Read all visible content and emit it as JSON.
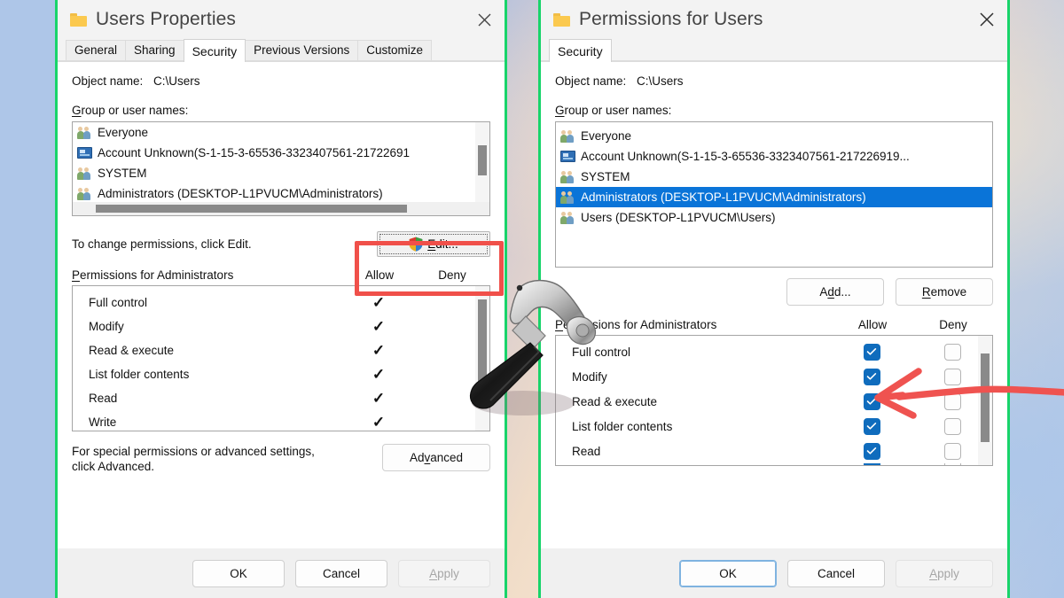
{
  "desktop": {
    "background_colors": [
      "#aec6e8",
      "#f6e3cd",
      "#d8cdd0"
    ],
    "border_color": "#18d46a"
  },
  "annotations": {
    "edit_highlight_color": "#f0504a",
    "arrow_color": "#ef5350",
    "hammer_icon": "hammer-icon",
    "arrow_icon": "red-arrow-icon",
    "edit_box_icon": "red-rectangle-highlight"
  },
  "left_dialog": {
    "title": "Users Properties",
    "folder_icon": "folder-icon",
    "close_icon": "close-icon",
    "tabs": [
      {
        "label": "General",
        "active": false
      },
      {
        "label": "Sharing",
        "active": false
      },
      {
        "label": "Security",
        "active": true
      },
      {
        "label": "Previous Versions",
        "active": false
      },
      {
        "label": "Customize",
        "active": false
      }
    ],
    "object_name_label": "Object name:",
    "object_name_value": "C:\\Users",
    "group_label": "Group or user names:",
    "group_items": [
      {
        "name": "Everyone",
        "icon": "users-group-icon",
        "selected": false
      },
      {
        "name": "Account Unknown(S-1-15-3-65536-3323407561-21722691",
        "icon": "unknown-account-icon",
        "selected": false
      },
      {
        "name": "SYSTEM",
        "icon": "users-group-icon",
        "selected": false
      },
      {
        "name": "Administrators (DESKTOP-L1PVUCM\\Administrators)",
        "icon": "users-group-icon",
        "selected": false
      }
    ],
    "change_hint": "To change permissions, click Edit.",
    "edit_button": "Edit...",
    "edit_button_icon": "uac-shield-icon",
    "permissions_label": "Permissions for Administrators",
    "allow_header": "Allow",
    "deny_header": "Deny",
    "permissions": [
      {
        "name": "Full control",
        "allow": "check",
        "deny": ""
      },
      {
        "name": "Modify",
        "allow": "check",
        "deny": ""
      },
      {
        "name": "Read & execute",
        "allow": "check",
        "deny": ""
      },
      {
        "name": "List folder contents",
        "allow": "check",
        "deny": ""
      },
      {
        "name": "Read",
        "allow": "check",
        "deny": ""
      },
      {
        "name": "Write",
        "allow": "check",
        "deny": ""
      }
    ],
    "advanced_note_line1": "For special permissions or advanced settings,",
    "advanced_note_line2": "click Advanced.",
    "advanced_button": "Advanced",
    "ok_button": "OK",
    "cancel_button": "Cancel",
    "apply_button": "Apply",
    "apply_disabled": true
  },
  "right_dialog": {
    "title": "Permissions for Users",
    "folder_icon": "folder-icon",
    "close_icon": "close-icon",
    "tabs": [
      {
        "label": "Security",
        "active": true
      }
    ],
    "object_name_label": "Object name:",
    "object_name_value": "C:\\Users",
    "group_label": "Group or user names:",
    "group_items": [
      {
        "name": "Everyone",
        "icon": "users-group-icon",
        "selected": false
      },
      {
        "name": "Account Unknown(S-1-15-3-65536-3323407561-217226919...",
        "icon": "unknown-account-icon",
        "selected": false
      },
      {
        "name": "SYSTEM",
        "icon": "users-group-icon",
        "selected": false
      },
      {
        "name": "Administrators (DESKTOP-L1PVUCM\\Administrators)",
        "icon": "users-group-icon",
        "selected": true
      },
      {
        "name": "Users (DESKTOP-L1PVUCM\\Users)",
        "icon": "users-group-icon",
        "selected": false
      }
    ],
    "add_button": "Add...",
    "remove_button": "Remove",
    "permissions_label": "Permissions for Administrators",
    "allow_header": "Allow",
    "deny_header": "Deny",
    "permissions": [
      {
        "name": "Full control",
        "allow": true,
        "deny": false
      },
      {
        "name": "Modify",
        "allow": true,
        "deny": false
      },
      {
        "name": "Read & execute",
        "allow": true,
        "deny": false
      },
      {
        "name": "List folder contents",
        "allow": true,
        "deny": false
      },
      {
        "name": "Read",
        "allow": true,
        "deny": false
      }
    ],
    "ok_button": "OK",
    "cancel_button": "Cancel",
    "apply_button": "Apply",
    "apply_disabled": true,
    "checkbox_color": "#0f6cbd"
  }
}
